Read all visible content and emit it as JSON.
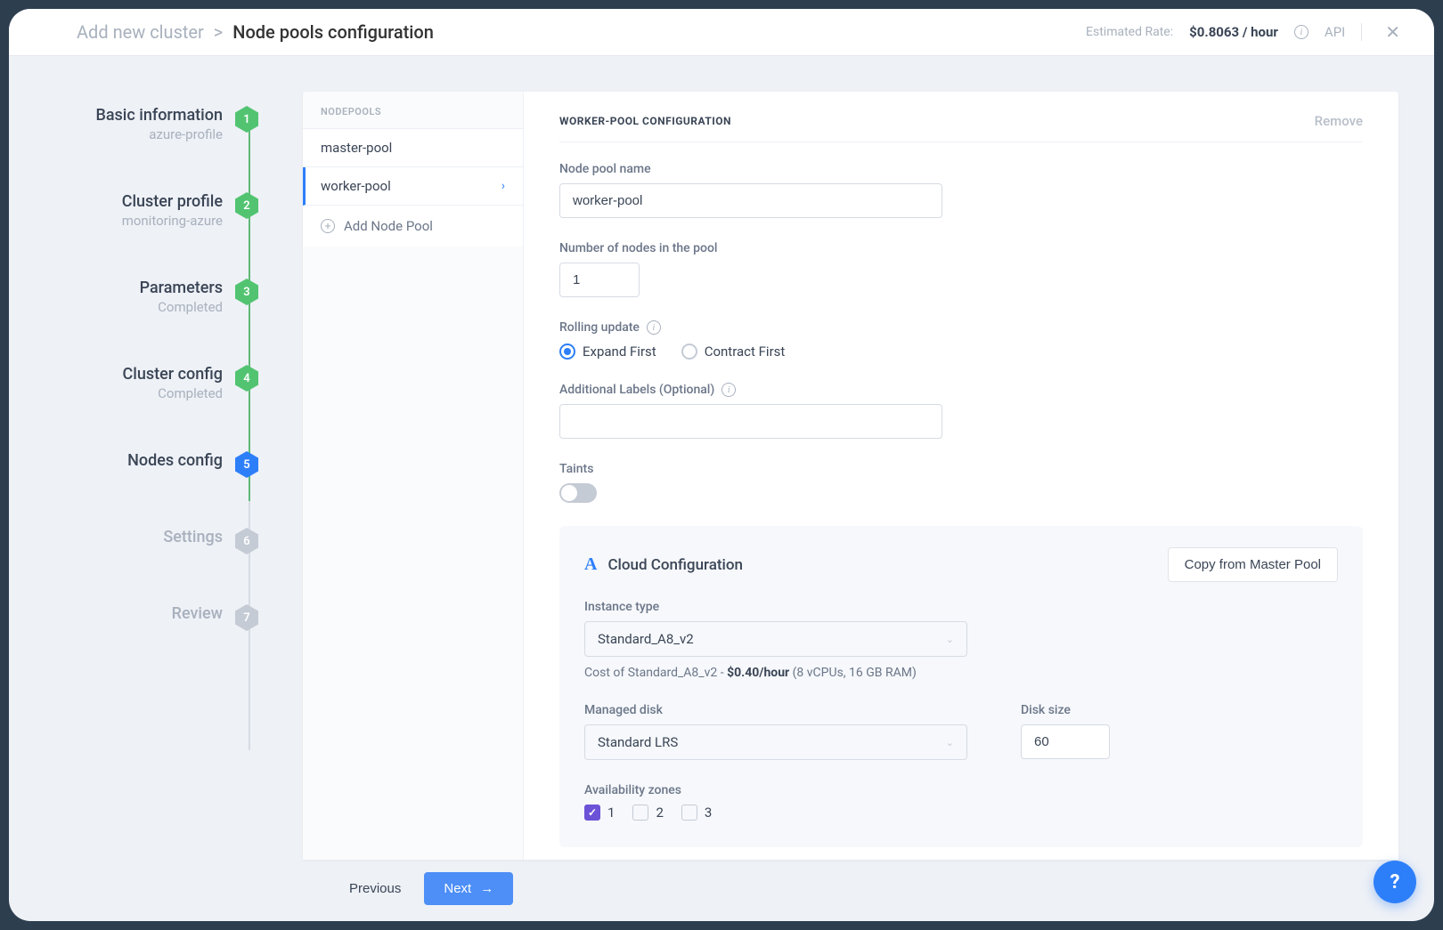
{
  "header": {
    "breadcrumb_root": "Add new cluster",
    "breadcrumb_sep": ">",
    "breadcrumb_current": "Node pools configuration",
    "rate_label": "Estimated Rate:",
    "rate_value": "$0.8063 / hour",
    "api_label": "API"
  },
  "steps": [
    {
      "title": "Basic information",
      "sub": "azure-profile",
      "num": "1",
      "style": "green"
    },
    {
      "title": "Cluster profile",
      "sub": "monitoring-azure",
      "num": "2",
      "style": "green"
    },
    {
      "title": "Parameters",
      "sub": "Completed",
      "num": "3",
      "style": "green"
    },
    {
      "title": "Cluster config",
      "sub": "Completed",
      "num": "4",
      "style": "green"
    },
    {
      "title": "Nodes config",
      "sub": "",
      "num": "5",
      "style": "blue"
    },
    {
      "title": "Settings",
      "sub": "",
      "num": "6",
      "style": "gray"
    },
    {
      "title": "Review",
      "sub": "",
      "num": "7",
      "style": "gray"
    }
  ],
  "pools": {
    "header": "NODEPOOLS",
    "items": [
      {
        "label": "master-pool",
        "active": false
      },
      {
        "label": "worker-pool",
        "active": true
      }
    ],
    "add_label": "Add Node Pool"
  },
  "form": {
    "title": "WORKER-POOL CONFIGURATION",
    "remove_label": "Remove",
    "pool_name_label": "Node pool name",
    "pool_name_value": "worker-pool",
    "node_count_label": "Number of nodes in the pool",
    "node_count_value": "1",
    "rolling_label": "Rolling update",
    "rolling_options": {
      "expand": "Expand First",
      "contract": "Contract First"
    },
    "labels_label": "Additional Labels (Optional)",
    "taints_label": "Taints",
    "cloud": {
      "title": "Cloud Configuration",
      "copy_button": "Copy from Master Pool",
      "instance_type_label": "Instance type",
      "instance_type_value": "Standard_A8_v2",
      "cost_prefix": "Cost of Standard_A8_v2 - ",
      "cost_value": "$0.40/hour",
      "cost_spec": " (8 vCPUs, 16 GB RAM)",
      "disk_label": "Managed disk",
      "disk_value": "Standard LRS",
      "disk_size_label": "Disk size",
      "disk_size_value": "60",
      "zones_label": "Availability zones",
      "zone1": "1",
      "zone2": "2",
      "zone3": "3"
    }
  },
  "footer": {
    "prev": "Previous",
    "next": "Next"
  },
  "help": "?"
}
